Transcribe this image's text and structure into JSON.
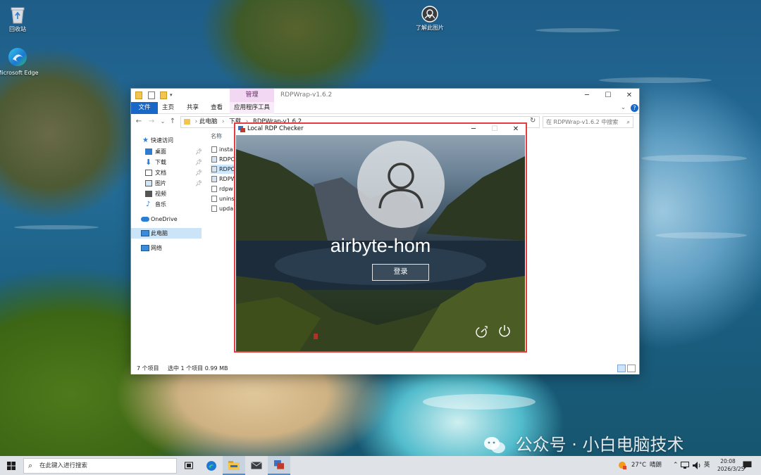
{
  "desktop": {
    "icons": [
      {
        "label": "回收站",
        "icon": "recycle-bin-icon"
      },
      {
        "label": "Microsoft Edge",
        "icon": "edge-icon"
      },
      {
        "label": "了解此图片",
        "icon": "learn-picture-icon"
      }
    ]
  },
  "explorer": {
    "manage_tab": "管理",
    "title": "RDPWrap-v1.6.2",
    "ribbon_tabs": [
      "文件",
      "主页",
      "共享",
      "查看",
      "应用程序工具"
    ],
    "breadcrumb": [
      "此电脑",
      "下载",
      "RDPWrap-v1.6.2"
    ],
    "search_placeholder": "在 RDPWrap-v1.6.2 中搜索",
    "nav": {
      "quick_access": "快速访问",
      "items": [
        "桌面",
        "下载",
        "文档",
        "图片",
        "视频",
        "音乐"
      ],
      "onedrive": "OneDrive",
      "this_pc": "此电脑",
      "network": "网络"
    },
    "column_name": "名称",
    "files": [
      "insta",
      "RDPC",
      "RDPC",
      "RDPW",
      "rdpw",
      "unins",
      "upda"
    ],
    "status_count": "7 个项目",
    "status_selected": "选中 1 个项目  0.99 MB"
  },
  "rdp": {
    "title": "Local RDP Checker",
    "user_name": "airbyte-hom",
    "login_label": "登录"
  },
  "watermark": "公众号 · 小白电脑技术",
  "taskbar": {
    "search_placeholder": "在此键入进行搜索",
    "weather_temp": "27°C",
    "weather_desc": "晴朗",
    "ime": "英",
    "time": "20:08",
    "date": "2026/3/25"
  },
  "colors": {
    "accent": "#1967c6",
    "highlight_border": "#e43d40",
    "manage_tab": "#f3d8f4"
  }
}
